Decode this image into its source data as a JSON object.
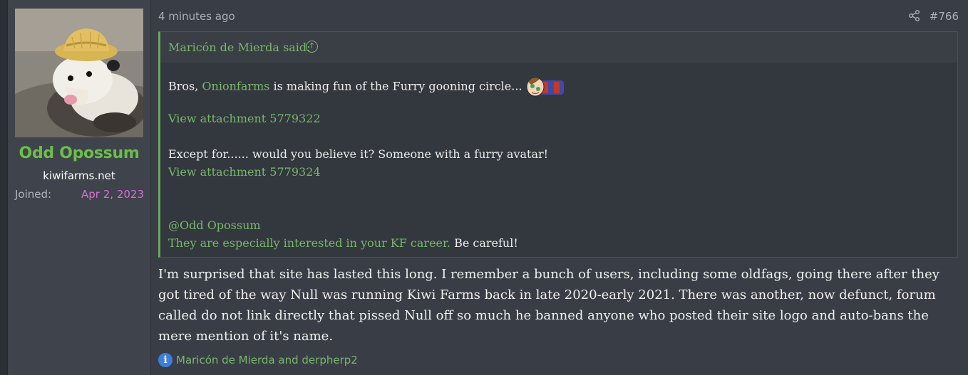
{
  "user": {
    "name": "Odd Opossum",
    "title": "kiwifarms.net",
    "joined_label": "Joined:",
    "joined_date": "Apr 2, 2023"
  },
  "post": {
    "time": "4 minutes ago",
    "number": "#766",
    "share_icon": "share-icon"
  },
  "quote": {
    "author_said": "Maricón de Mierda said:",
    "jump_icon": "arrow-up-circle-icon",
    "line1_pre": "Bros, ",
    "line1_link": "Onionfarms",
    "line1_post": " is making fun of the Furry gooning circle...",
    "attachment1": "View attachment 5779322",
    "line3": "Except for...... would you believe it? Someone with a furry avatar!",
    "attachment2": "View attachment 5779324",
    "mention": "@Odd Opossum",
    "last_link": "They are especially interested in your KF career.",
    "last_text": " Be careful!"
  },
  "reply": {
    "lines": [
      "I'm surprised that site has lasted this long. I remember a bunch of users, including some oldfags, going there after they",
      "got tired of the way Null was running Kiwi Farms back in late 2020-early 2021. There was another, now defunct, forum",
      "called do not link directly that pissed Null off so much he banned anyone who posted their site logo and auto-bans the",
      "mere mention of it's name."
    ]
  },
  "reactions": {
    "icon": "info-icon",
    "icon_glyph": "i",
    "users": "Maricón de Mierda and derpherp2"
  },
  "colors": {
    "background": "#2b2f36",
    "post_bg": "#393d45",
    "username": "#6bbf48",
    "link": "#78b86a",
    "joined_date": "#d86fd8",
    "reaction_icon": "#3c7ee0"
  }
}
